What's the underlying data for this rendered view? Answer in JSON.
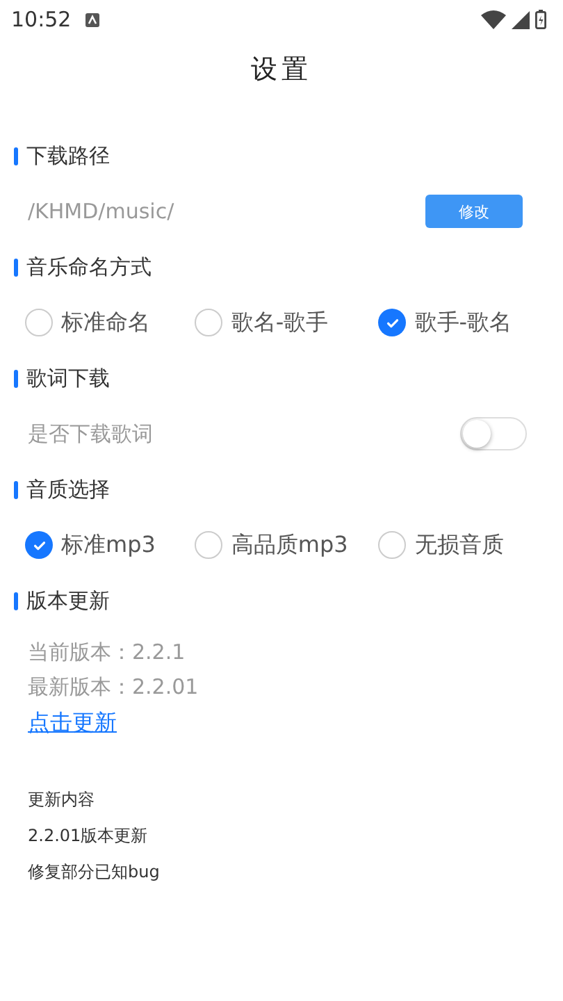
{
  "status_bar": {
    "time": "10:52"
  },
  "title": "设置",
  "sections": [
    {
      "kind": "path",
      "heading": "下载路径",
      "path": "/KHMD/music/",
      "button": "修改"
    },
    {
      "kind": "radios",
      "heading": "音乐命名方式",
      "options": [
        {
          "label": "标准命名",
          "selected": false
        },
        {
          "label": "歌名-歌手",
          "selected": false
        },
        {
          "label": "歌手-歌名",
          "selected": true
        }
      ]
    },
    {
      "kind": "toggle",
      "heading": "歌词下载",
      "label": "是否下载歌词",
      "on": false
    },
    {
      "kind": "radios",
      "heading": "音质选择",
      "options": [
        {
          "label": "标准mp3",
          "selected": true
        },
        {
          "label": "高品质mp3",
          "selected": false
        },
        {
          "label": "无损音质",
          "selected": false
        }
      ]
    },
    {
      "kind": "version",
      "heading": "版本更新",
      "current": "当前版本：2.2.1",
      "latest": "最新版本：2.2.01",
      "link": "点击更新",
      "notes": [
        "更新内容",
        "2.2.01版本更新",
        "修复部分已知bug"
      ]
    }
  ]
}
